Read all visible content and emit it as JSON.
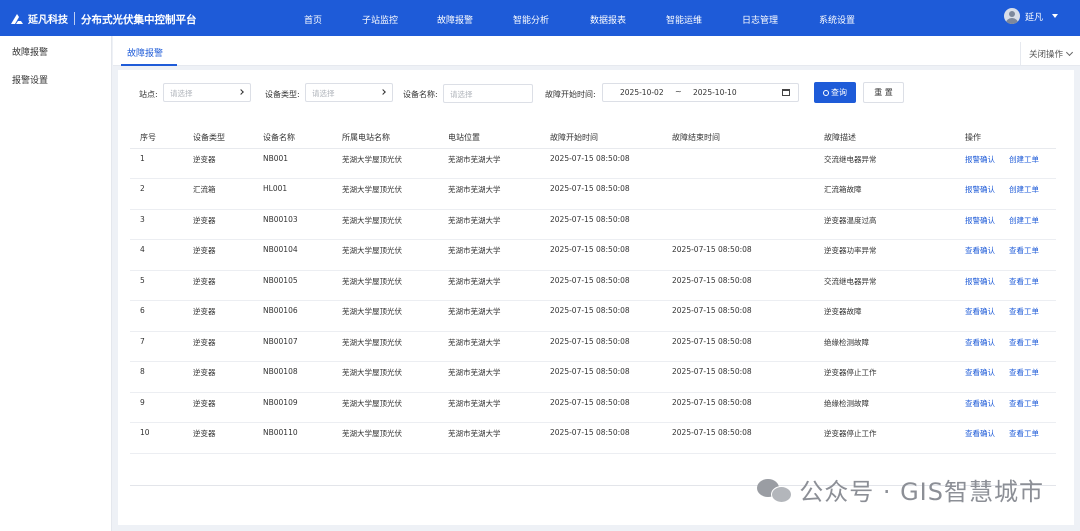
{
  "header": {
    "logo_text": "延凡科技",
    "app_title": "分布式光伏集中控制平台",
    "nav": [
      "首页",
      "子站监控",
      "故障报警",
      "智能分析",
      "数据报表",
      "智能运维",
      "日志管理",
      "系统设置"
    ],
    "user_name": "延凡"
  },
  "sidebar": {
    "items": [
      "故障报警",
      "报警设置"
    ]
  },
  "tabs": {
    "active": "故障报警",
    "close_ops": "关闭操作"
  },
  "filters": {
    "station_label": "站点:",
    "station_placeholder": "请选择",
    "device_type_label": "设备类型:",
    "device_type_placeholder": "请选择",
    "device_name_label": "设备名称:",
    "device_name_placeholder": "请选择",
    "fault_start_label": "故障开始时间:",
    "date_from": "2025-10-02",
    "date_sep": "~",
    "date_to": "2025-10-10",
    "query_label": "查询",
    "reset_label": "重 置"
  },
  "table": {
    "columns": [
      "序号",
      "设备类型",
      "设备名称",
      "所属电站名称",
      "电站位置",
      "故障开始时间",
      "故障结束时间",
      "故障描述",
      "操作"
    ],
    "rows": [
      {
        "no": "1",
        "type": "逆变器",
        "name": "NB001",
        "station": "芜湖大学屋顶光伏",
        "location": "芜湖市芜湖大学",
        "start": "2025-07-15 08:50:08",
        "end": "",
        "desc": "交流继电器异常",
        "op1": "报警确认",
        "op2": "创建工单"
      },
      {
        "no": "2",
        "type": "汇流箱",
        "name": "HL001",
        "station": "芜湖大学屋顶光伏",
        "location": "芜湖市芜湖大学",
        "start": "2025-07-15 08:50:08",
        "end": "",
        "desc": "汇流箱故障",
        "op1": "报警确认",
        "op2": "创建工单"
      },
      {
        "no": "3",
        "type": "逆变器",
        "name": "NB00103",
        "station": "芜湖大学屋顶光伏",
        "location": "芜湖市芜湖大学",
        "start": "2025-07-15 08:50:08",
        "end": "",
        "desc": "逆变器温度过高",
        "op1": "报警确认",
        "op2": "创建工单"
      },
      {
        "no": "4",
        "type": "逆变器",
        "name": "NB00104",
        "station": "芜湖大学屋顶光伏",
        "location": "芜湖市芜湖大学",
        "start": "2025-07-15 08:50:08",
        "end": "2025-07-15 08:50:08",
        "desc": "逆变器功率异常",
        "op1": "查看确认",
        "op2": "查看工单"
      },
      {
        "no": "5",
        "type": "逆变器",
        "name": "NB00105",
        "station": "芜湖大学屋顶光伏",
        "location": "芜湖市芜湖大学",
        "start": "2025-07-15 08:50:08",
        "end": "2025-07-15 08:50:08",
        "desc": "交流继电器异常",
        "op1": "报警确认",
        "op2": "查看工单"
      },
      {
        "no": "6",
        "type": "逆变器",
        "name": "NB00106",
        "station": "芜湖大学屋顶光伏",
        "location": "芜湖市芜湖大学",
        "start": "2025-07-15 08:50:08",
        "end": "2025-07-15 08:50:08",
        "desc": "逆变器故障",
        "op1": "查看确认",
        "op2": "查看工单"
      },
      {
        "no": "7",
        "type": "逆变器",
        "name": "NB00107",
        "station": "芜湖大学屋顶光伏",
        "location": "芜湖市芜湖大学",
        "start": "2025-07-15 08:50:08",
        "end": "2025-07-15 08:50:08",
        "desc": "绝缘检测故障",
        "op1": "查看确认",
        "op2": "查看工单"
      },
      {
        "no": "8",
        "type": "逆变器",
        "name": "NB00108",
        "station": "芜湖大学屋顶光伏",
        "location": "芜湖市芜湖大学",
        "start": "2025-07-15 08:50:08",
        "end": "2025-07-15 08:50:08",
        "desc": "逆变器停止工作",
        "op1": "查看确认",
        "op2": "查看工单"
      },
      {
        "no": "9",
        "type": "逆变器",
        "name": "NB00109",
        "station": "芜湖大学屋顶光伏",
        "location": "芜湖市芜湖大学",
        "start": "2025-07-15 08:50:08",
        "end": "2025-07-15 08:50:08",
        "desc": "绝缘检测故障",
        "op1": "查看确认",
        "op2": "查看工单"
      },
      {
        "no": "10",
        "type": "逆变器",
        "name": "NB00110",
        "station": "芜湖大学屋顶光伏",
        "location": "芜湖市芜湖大学",
        "start": "2025-07-15 08:50:08",
        "end": "2025-07-15 08:50:08",
        "desc": "逆变器停止工作",
        "op1": "查看确认",
        "op2": "查看工单"
      }
    ]
  },
  "watermark": "公众号 · GIS智慧城市",
  "colors": {
    "primary": "#1e5bd8",
    "link": "#1e5bd8"
  }
}
